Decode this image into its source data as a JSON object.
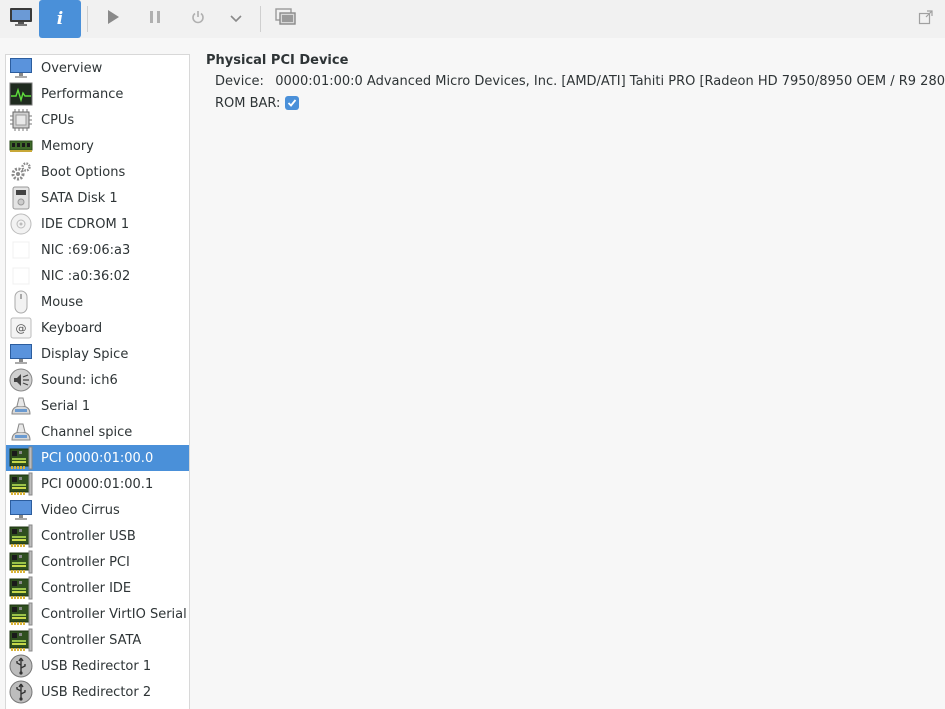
{
  "toolbar": {
    "buttons": [
      {
        "name": "console-button",
        "icon": "monitor-icon"
      },
      {
        "name": "details-button",
        "icon": "info-icon",
        "glyph": "i"
      },
      {
        "name": "run-button",
        "icon": "play-icon"
      },
      {
        "name": "pause-button",
        "icon": "pause-icon"
      },
      {
        "name": "shutdown-button",
        "icon": "power-icon"
      },
      {
        "name": "shutdown-menu-button",
        "icon": "chevron-down-icon"
      },
      {
        "name": "snapshots-button",
        "icon": "snapshot-icon"
      },
      {
        "name": "fullscreen-button",
        "icon": "fullscreen-icon"
      }
    ]
  },
  "sidebar": {
    "items": [
      {
        "label": "Overview",
        "icon": "monitor-icon"
      },
      {
        "label": "Performance",
        "icon": "performance-icon"
      },
      {
        "label": "CPUs",
        "icon": "cpu-icon"
      },
      {
        "label": "Memory",
        "icon": "memory-icon"
      },
      {
        "label": "Boot Options",
        "icon": "gears-icon"
      },
      {
        "label": "SATA Disk 1",
        "icon": "disk-icon"
      },
      {
        "label": "IDE CDROM 1",
        "icon": "cdrom-icon"
      },
      {
        "label": "NIC :69:06:a3",
        "icon": "nic-icon"
      },
      {
        "label": "NIC :a0:36:02",
        "icon": "nic-icon"
      },
      {
        "label": "Mouse",
        "icon": "mouse-icon"
      },
      {
        "label": "Keyboard",
        "icon": "keyboard-icon"
      },
      {
        "label": "Display Spice",
        "icon": "monitor-icon"
      },
      {
        "label": "Sound: ich6",
        "icon": "sound-icon"
      },
      {
        "label": "Serial 1",
        "icon": "serial-icon"
      },
      {
        "label": "Channel spice",
        "icon": "serial-icon"
      },
      {
        "label": "PCI 0000:01:00.0",
        "icon": "pci-card-icon",
        "selected": true
      },
      {
        "label": "PCI 0000:01:00.1",
        "icon": "pci-card-icon"
      },
      {
        "label": "Video Cirrus",
        "icon": "monitor-icon"
      },
      {
        "label": "Controller USB",
        "icon": "pci-card-icon"
      },
      {
        "label": "Controller PCI",
        "icon": "pci-card-icon"
      },
      {
        "label": "Controller IDE",
        "icon": "pci-card-icon"
      },
      {
        "label": "Controller VirtIO Serial",
        "icon": "pci-card-icon"
      },
      {
        "label": "Controller SATA",
        "icon": "pci-card-icon"
      },
      {
        "label": "USB Redirector 1",
        "icon": "usb-icon"
      },
      {
        "label": "USB Redirector 2",
        "icon": "usb-icon"
      }
    ]
  },
  "detail": {
    "title": "Physical PCI Device",
    "device_label": "Device:",
    "device_value": "0000:01:00:0 Advanced Micro Devices, Inc. [AMD/ATI] Tahiti PRO [Radeon HD 7950/8950 OEM / R9 280",
    "rom_bar_label": "ROM BAR:",
    "rom_bar_checked": true
  },
  "colors": {
    "accent": "#4a90d9",
    "selection_text": "#ffffff",
    "text": "#2e3436",
    "icon_gray": "#8a8a8a"
  }
}
